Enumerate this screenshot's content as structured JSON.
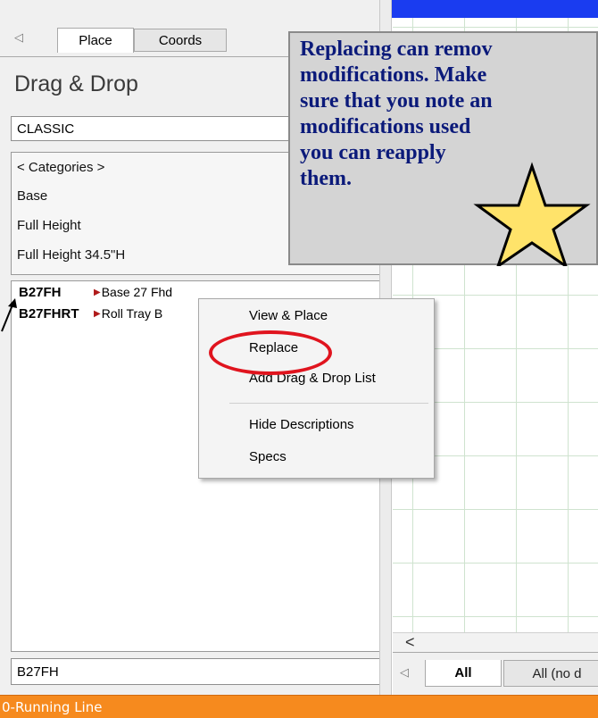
{
  "left_panel": {
    "tabs": [
      {
        "label": "Place",
        "active": true
      },
      {
        "label": "Coords",
        "active": false
      }
    ],
    "scroll_left_glyph": "◁",
    "title": "Drag & Drop",
    "catalog_field_value": "CLASSIC",
    "categories": [
      "< Categories >",
      "Base",
      "Full Height",
      "Full Height 34.5\"H"
    ],
    "items": [
      {
        "code": "B27FH",
        "marker": "▶",
        "description": "Base 27 Fhd"
      },
      {
        "code": "B27FHRT",
        "marker": "▶",
        "description": "Roll Tray B"
      }
    ],
    "selected_field_value": "B27FH"
  },
  "context_menu": {
    "items": [
      "View & Place",
      "Replace",
      "Add Drag & Drop List",
      "Hide Descriptions",
      "Specs"
    ],
    "highlighted": "Replace"
  },
  "callout": {
    "text": "Replacing can remov\nmodifications. Make\nsure that you note an\nmodifications used\nyou can reapply\nthem."
  },
  "drawing_area": {
    "hscroll_left_glyph": "<",
    "tabs": [
      {
        "label": "All",
        "active": true
      },
      {
        "label": "All (no d",
        "active": false
      }
    ],
    "scroll_left_glyph": "◁"
  },
  "status_bar": {
    "text": "0-Running Line"
  },
  "colors": {
    "top_bar": "#1a3cf0",
    "status_bar": "#f68a1e",
    "callout_text": "#0b1a7a",
    "highlight_ring": "#e0141e",
    "star_fill": "#ffe36a"
  }
}
